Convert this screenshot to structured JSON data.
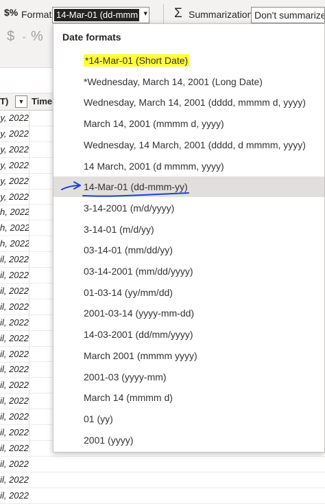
{
  "ribbon": {
    "format_label": "Format",
    "format_value": "14-Mar-01 (dd-mmm",
    "summarization_label": "Summarization",
    "summarization_value": "Don't summarize",
    "currency_symbol": "$",
    "percent_symbol": "%"
  },
  "grid": {
    "col1_header": "T)",
    "col2_header": "Times",
    "rows": [
      "y, 2022",
      "y, 2022",
      "y, 2022",
      "y, 2022",
      "y, 2022",
      "y, 2022",
      "h, 2022",
      "h, 2022",
      "h, 2022",
      "il, 2022",
      "il, 2022",
      "il, 2022",
      "il, 2022",
      "il, 2022",
      "il, 2022",
      "il, 2022",
      "il, 2022",
      "il, 2022",
      "il, 2022",
      "il, 2022",
      "il, 2022",
      "il, 2022",
      "il, 2022",
      "il, 2022",
      "il, 2022"
    ]
  },
  "dropdown": {
    "header": "Date formats",
    "items": [
      {
        "label": "*14-Mar-01 (Short Date)",
        "highlighted": true
      },
      {
        "label": "*Wednesday, March 14, 2001 (Long Date)"
      },
      {
        "label": "Wednesday, March 14, 2001 (dddd, mmmm d, yyyy)"
      },
      {
        "label": "March 14, 2001 (mmmm d, yyyy)"
      },
      {
        "label": "Wednesday, 14 March, 2001 (dddd, d mmmm, yyyy)"
      },
      {
        "label": "14 March, 2001 (d mmmm, yyyy)"
      },
      {
        "label": "14-Mar-01 (dd-mmm-yy)",
        "selected": true
      },
      {
        "label": "3-14-2001 (m/d/yyyy)"
      },
      {
        "label": "3-14-01 (m/d/yy)"
      },
      {
        "label": "03-14-01 (mm/dd/yy)"
      },
      {
        "label": "03-14-2001 (mm/dd/yyyy)"
      },
      {
        "label": "01-03-14 (yy/mm/dd)"
      },
      {
        "label": "2001-03-14 (yyyy-mm-dd)"
      },
      {
        "label": "14-03-2001 (dd/mm/yyyy)"
      },
      {
        "label": "March 2001 (mmmm yyyy)"
      },
      {
        "label": "2001-03 (yyyy-mm)"
      },
      {
        "label": "March 14 (mmmm d)"
      },
      {
        "label": "01 (yy)"
      },
      {
        "label": "2001 (yyyy)"
      }
    ]
  },
  "colors": {
    "highlight": "#fffd38",
    "selected_row": "#e1dfdd",
    "annotation_ink": "#1a3fd6"
  }
}
